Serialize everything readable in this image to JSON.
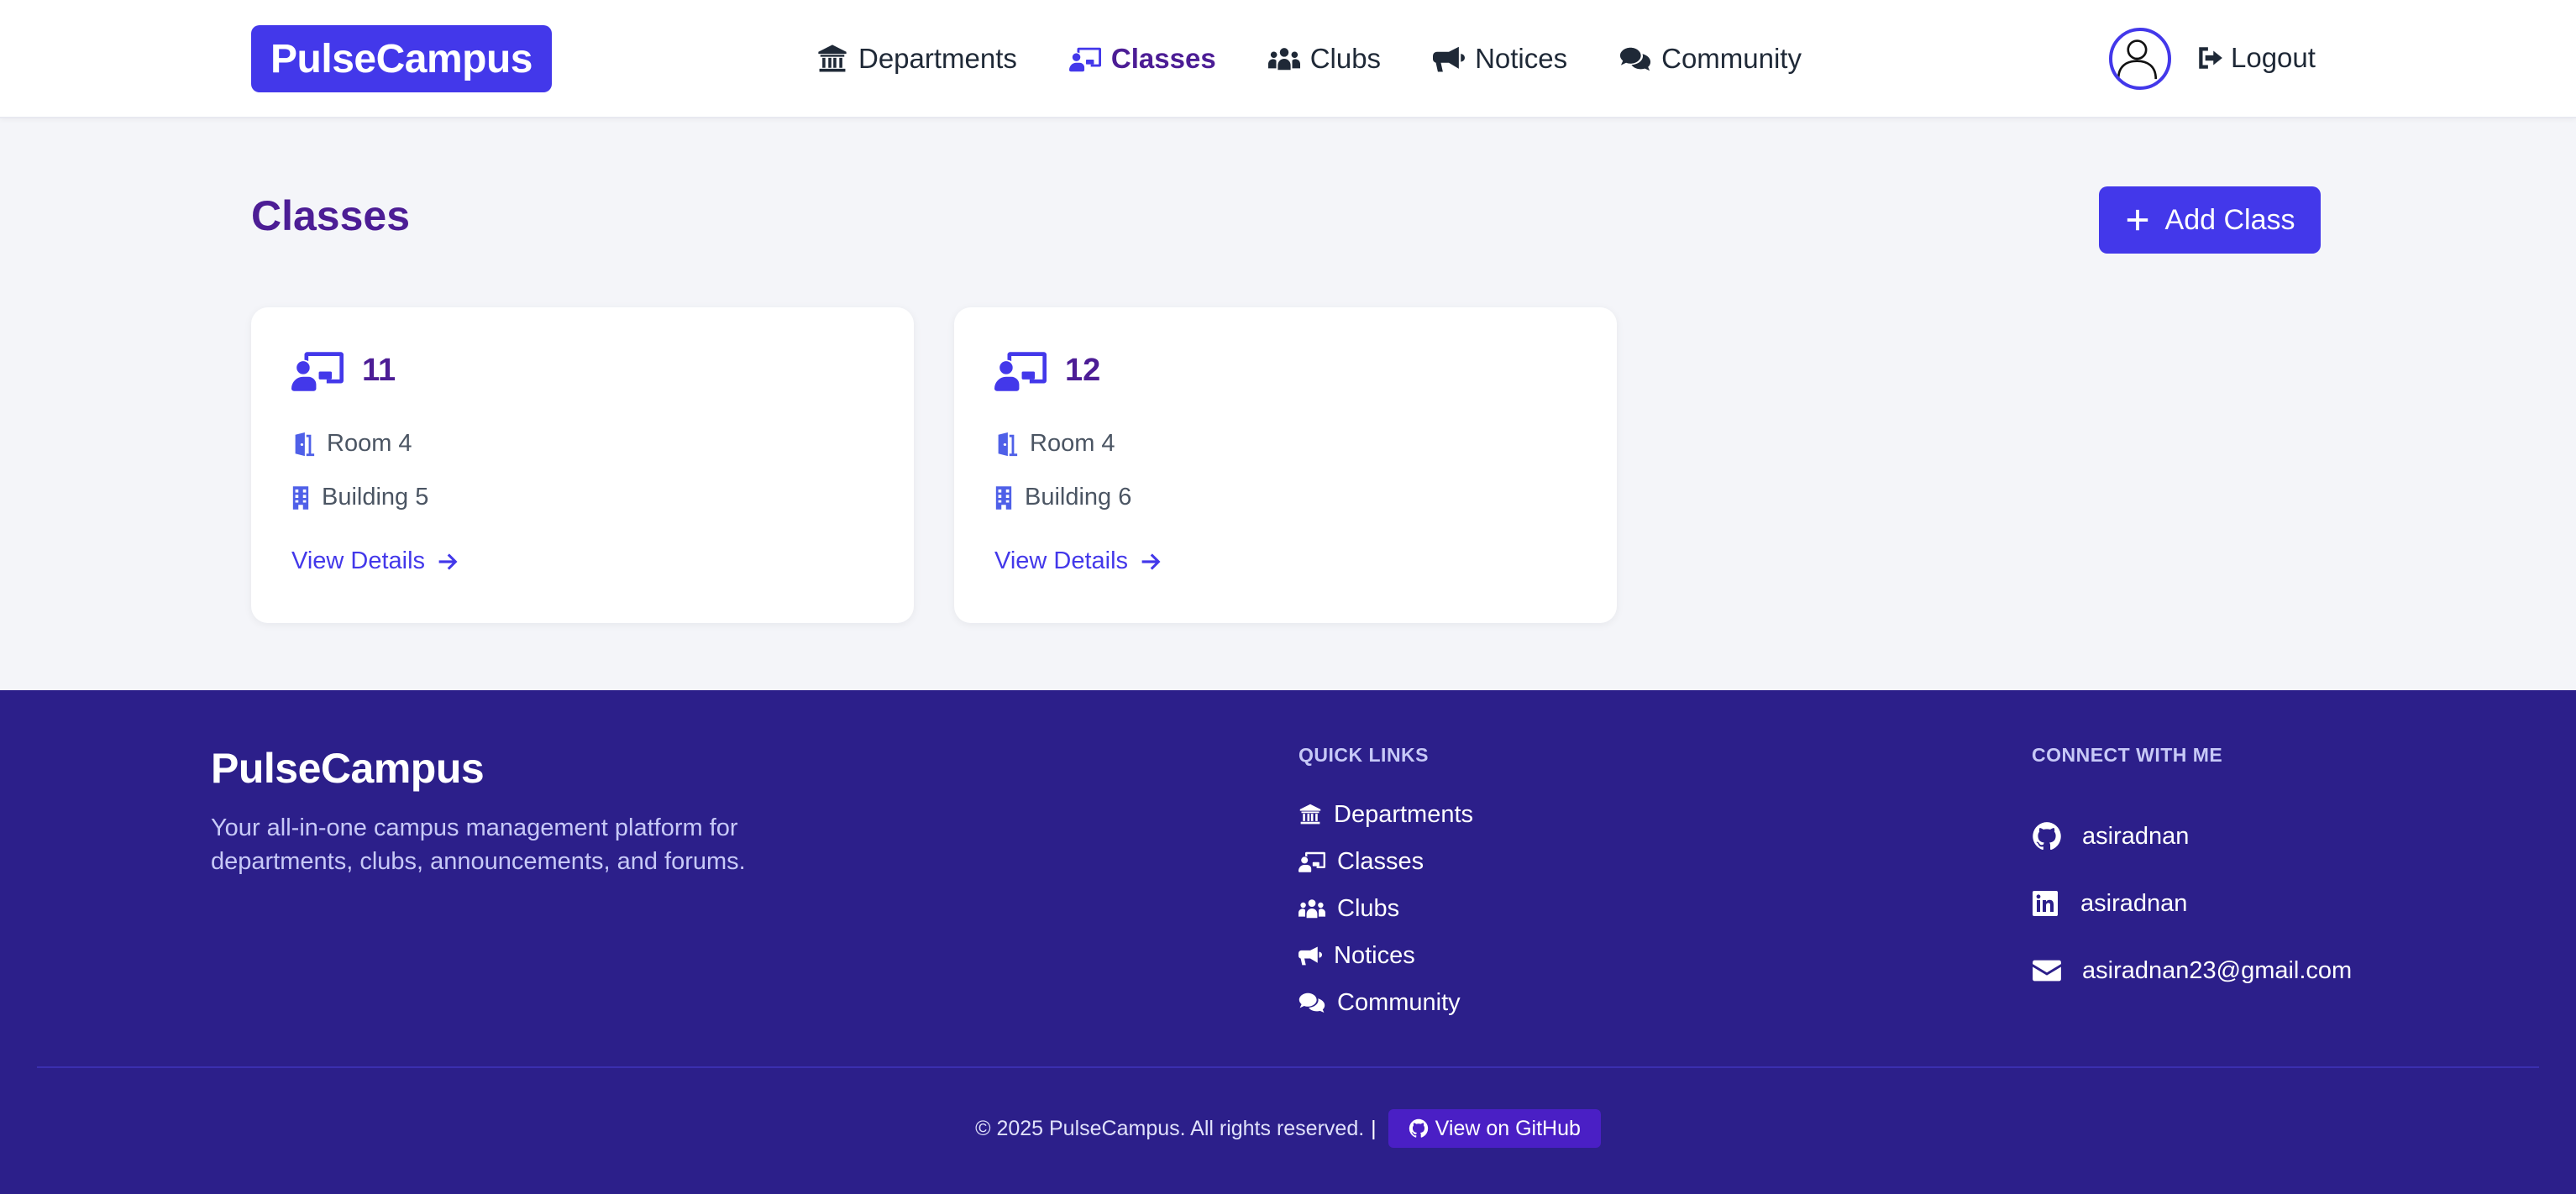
{
  "brand": "PulseCampus",
  "nav": {
    "items": [
      {
        "label": "Departments",
        "icon": "building-columns-icon"
      },
      {
        "label": "Classes",
        "icon": "chalkboard-user-icon",
        "active": true
      },
      {
        "label": "Clubs",
        "icon": "people-group-icon"
      },
      {
        "label": "Notices",
        "icon": "bullhorn-icon"
      },
      {
        "label": "Community",
        "icon": "comments-icon"
      }
    ],
    "logout": "Logout"
  },
  "page": {
    "title": "Classes",
    "add_button": "Add Class"
  },
  "classes": [
    {
      "name": "11",
      "room": "Room 4",
      "building": "Building 5",
      "link": "View Details"
    },
    {
      "name": "12",
      "room": "Room 4",
      "building": "Building 6",
      "link": "View Details"
    }
  ],
  "footer": {
    "brand": "PulseCampus",
    "description": "Your all-in-one campus management platform for departments, clubs, announcements, and forums.",
    "quick_links_heading": "QUICK LINKS",
    "quick_links": [
      "Departments",
      "Classes",
      "Clubs",
      "Notices",
      "Community"
    ],
    "connect_heading": "CONNECT WITH ME",
    "connect": [
      {
        "label": "asiradnan",
        "icon": "github-icon"
      },
      {
        "label": "asiradnan",
        "icon": "linkedin-icon"
      },
      {
        "label": "asiradnan23@gmail.com",
        "icon": "envelope-icon"
      }
    ],
    "copyright": "© 2025 PulseCampus. All rights reserved.",
    "separator": "|",
    "github_button": "View on GitHub"
  },
  "colors": {
    "primary": "#4338ea",
    "title_purple": "#4c1d95",
    "footer_bg": "#2c1f8a",
    "page_bg": "#f4f5f9"
  }
}
